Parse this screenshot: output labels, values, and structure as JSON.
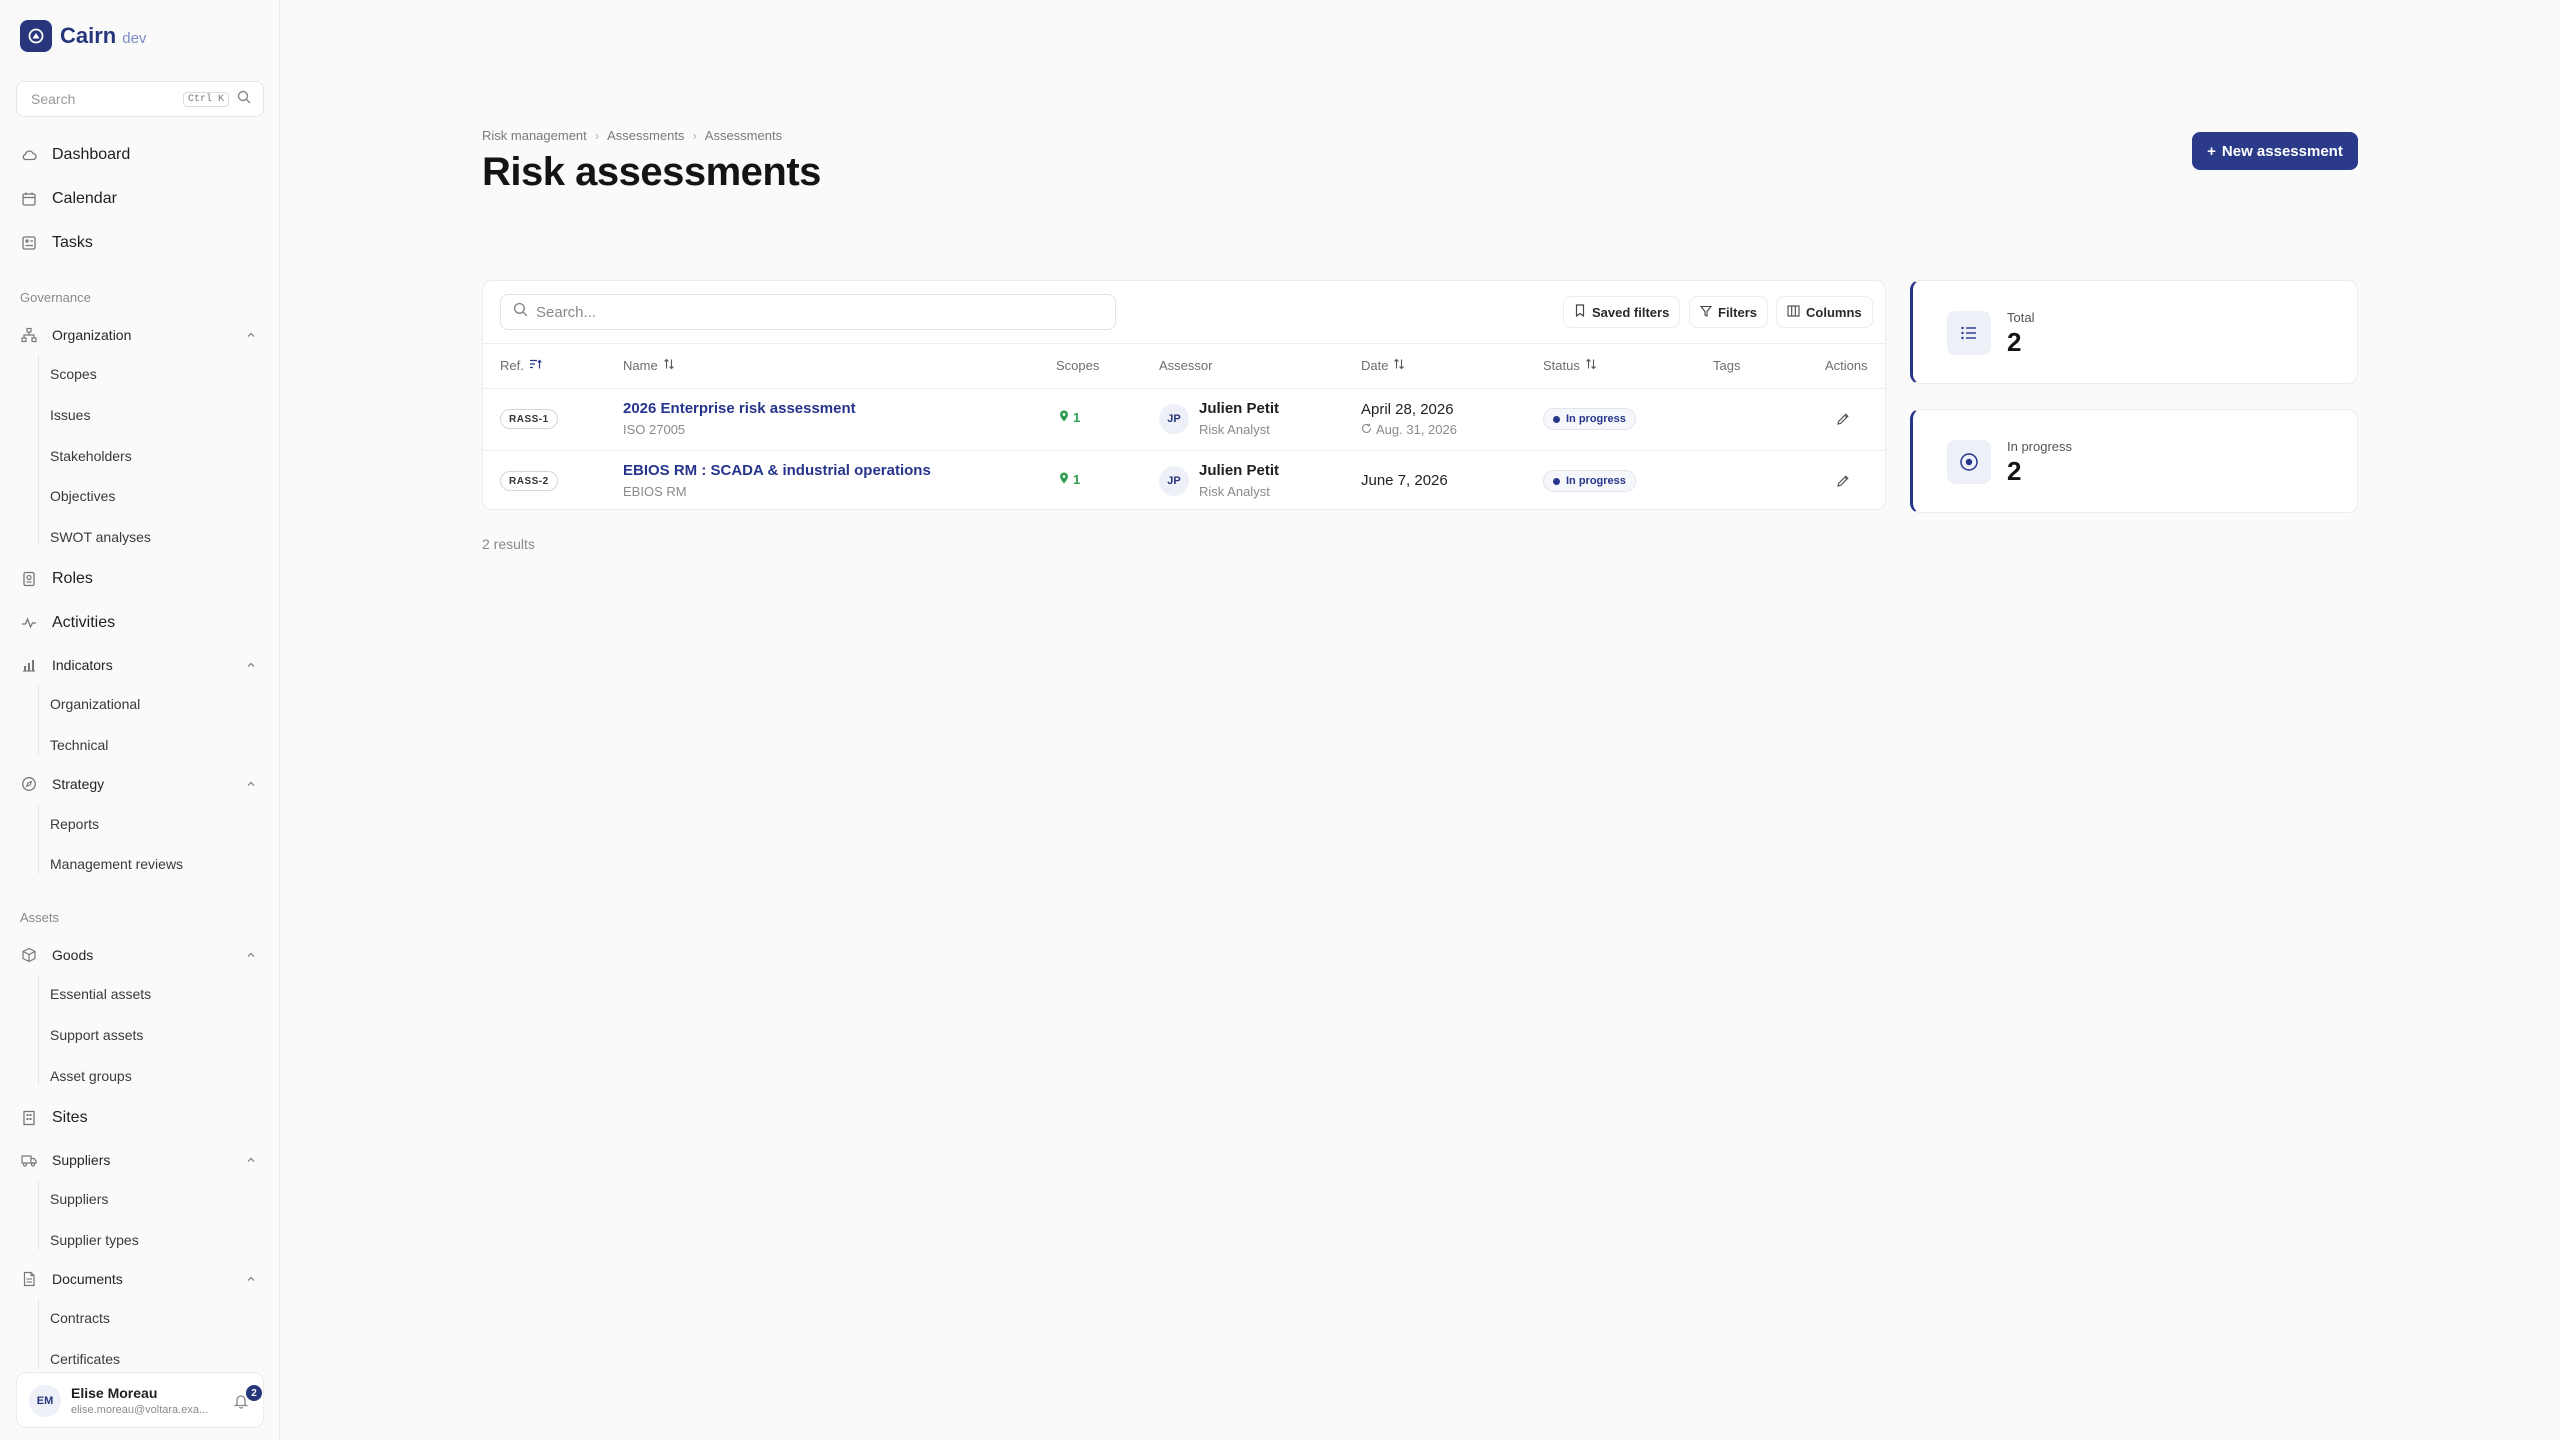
{
  "brand": {
    "name": "Cairn",
    "env": "dev"
  },
  "sidebar": {
    "search_placeholder": "Search",
    "search_shortcut": "Ctrl K",
    "main_items": [
      {
        "label": "Dashboard",
        "icon": "cloud-icon"
      },
      {
        "label": "Calendar",
        "icon": "calendar-icon"
      },
      {
        "label": "Tasks",
        "icon": "tasks-icon"
      }
    ],
    "sections": {
      "governance": "Governance",
      "assets": "Assets"
    },
    "organization": {
      "label": "Organization",
      "items": [
        "Scopes",
        "Issues",
        "Stakeholders",
        "Objectives",
        "SWOT analyses"
      ]
    },
    "roles": "Roles",
    "activities": "Activities",
    "indicators": {
      "label": "Indicators",
      "items": [
        "Organizational",
        "Technical"
      ]
    },
    "strategy": {
      "label": "Strategy",
      "items": [
        "Reports",
        "Management reviews"
      ]
    },
    "goods": {
      "label": "Goods",
      "items": [
        "Essential assets",
        "Support assets",
        "Asset groups"
      ]
    },
    "sites": "Sites",
    "suppliers": {
      "label": "Suppliers",
      "items": [
        "Suppliers",
        "Supplier types"
      ]
    },
    "documents": {
      "label": "Documents",
      "items": [
        "Contracts",
        "Certificates"
      ]
    }
  },
  "user": {
    "initials": "EM",
    "name": "Elise Moreau",
    "email": "elise.moreau@voltara.exa...",
    "notifications": "2"
  },
  "breadcrumb": [
    "Risk management",
    "Assessments",
    "Assessments"
  ],
  "page_title": "Risk assessments",
  "new_button": "New assessment",
  "table": {
    "search_placeholder": "Search...",
    "tools": {
      "saved_filters": "Saved filters",
      "filters": "Filters",
      "columns": "Columns"
    },
    "headers": {
      "ref": "Ref.",
      "name": "Name",
      "scopes": "Scopes",
      "assessor": "Assessor",
      "date": "Date",
      "status": "Status",
      "tags": "Tags",
      "actions": "Actions"
    },
    "rows": [
      {
        "ref": "RASS-1",
        "name": "2026 Enterprise risk assessment",
        "framework": "ISO 27005",
        "scopes": "1",
        "assessor_initials": "JP",
        "assessor_name": "Julien Petit",
        "assessor_role": "Risk Analyst",
        "date": "April 28, 2026",
        "due_date": "Aug. 31, 2026",
        "status": "In progress"
      },
      {
        "ref": "RASS-2",
        "name": "EBIOS RM : SCADA & industrial operations",
        "framework": "EBIOS RM",
        "scopes": "1",
        "assessor_initials": "JP",
        "assessor_name": "Julien Petit",
        "assessor_role": "Risk Analyst",
        "date": "June 7, 2026",
        "due_date": "",
        "status": "In progress"
      }
    ],
    "results": "2 results"
  },
  "stats": [
    {
      "label": "Total",
      "value": "2",
      "icon": "list-icon"
    },
    {
      "label": "In progress",
      "value": "2",
      "icon": "target-icon"
    }
  ],
  "colors": {
    "brand": "#27357a",
    "primary_button": "#2b3b8a",
    "link": "#26358c",
    "scope_green": "#2f9e52"
  }
}
